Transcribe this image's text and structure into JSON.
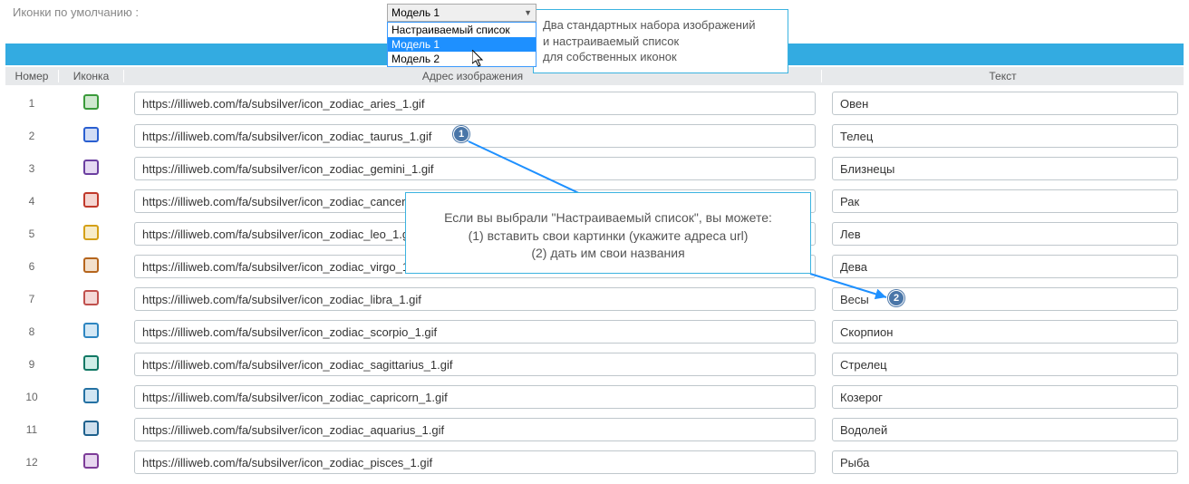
{
  "topLabel": "Иконки по умолчанию :",
  "select": {
    "selected": "Модель 1",
    "options": [
      "Настраиваемый список",
      "Модель 1",
      "Модель 2"
    ]
  },
  "tooltip1": {
    "line1": "Два стандартных набора изображений",
    "line2": "и настраиваемый список",
    "line3": "для собственных иконок"
  },
  "headers": {
    "num": "Номер",
    "icon": "Иконка",
    "addr": "Адрес изображения",
    "text": "Текст"
  },
  "rows": [
    {
      "n": "1",
      "addr": "https://illiweb.com/fa/subsilver/icon_zodiac_aries_1.gif",
      "text": "Овен"
    },
    {
      "n": "2",
      "addr": "https://illiweb.com/fa/subsilver/icon_zodiac_taurus_1.gif",
      "text": "Телец"
    },
    {
      "n": "3",
      "addr": "https://illiweb.com/fa/subsilver/icon_zodiac_gemini_1.gif",
      "text": "Близнецы"
    },
    {
      "n": "4",
      "addr": "https://illiweb.com/fa/subsilver/icon_zodiac_cancer_1.gif",
      "text": "Рак"
    },
    {
      "n": "5",
      "addr": "https://illiweb.com/fa/subsilver/icon_zodiac_leo_1.gif",
      "text": "Лев"
    },
    {
      "n": "6",
      "addr": "https://illiweb.com/fa/subsilver/icon_zodiac_virgo_1.gif",
      "text": "Дева"
    },
    {
      "n": "7",
      "addr": "https://illiweb.com/fa/subsilver/icon_zodiac_libra_1.gif",
      "text": "Весы"
    },
    {
      "n": "8",
      "addr": "https://illiweb.com/fa/subsilver/icon_zodiac_scorpio_1.gif",
      "text": "Скорпион"
    },
    {
      "n": "9",
      "addr": "https://illiweb.com/fa/subsilver/icon_zodiac_sagittarius_1.gif",
      "text": "Стрелец"
    },
    {
      "n": "10",
      "addr": "https://illiweb.com/fa/subsilver/icon_zodiac_capricorn_1.gif",
      "text": "Козерог"
    },
    {
      "n": "11",
      "addr": "https://illiweb.com/fa/subsilver/icon_zodiac_aquarius_1.gif",
      "text": "Водолей"
    },
    {
      "n": "12",
      "addr": "https://illiweb.com/fa/subsilver/icon_zodiac_pisces_1.gif",
      "text": "Рыба"
    }
  ],
  "tooltip2": {
    "line1": "Если вы выбрали \"Настраиваемый список\", вы можете:",
    "line2": "(1) вставить свои картинки (укажите адреса url)",
    "line3": "(2) дать им свои названия"
  },
  "badges": {
    "b1": "1",
    "b2": "2"
  }
}
